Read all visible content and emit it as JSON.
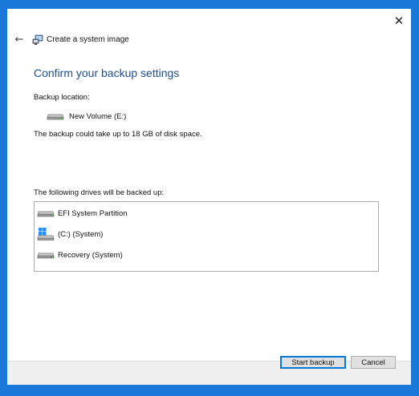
{
  "window": {
    "title": "Create a system image",
    "close_glyph": "✕",
    "back_glyph": "←"
  },
  "page": {
    "heading": "Confirm your backup settings",
    "location_label": "Backup location:",
    "location_value": "New Volume (E:)",
    "space_note": "The backup could take up to 18 GB of disk space.",
    "drives_label": "The following drives will be backed up:"
  },
  "drives": [
    {
      "label": "EFI System Partition",
      "icon": "drive-icon"
    },
    {
      "label": "(C:) (System)",
      "icon": "windows-drive-icon"
    },
    {
      "label": "Recovery (System)",
      "icon": "drive-icon"
    }
  ],
  "buttons": {
    "start": "Start backup",
    "cancel": "Cancel"
  },
  "colors": {
    "background": "#1a78d8",
    "heading": "#1d4f8c",
    "windows_logo": "#1e90ff"
  }
}
